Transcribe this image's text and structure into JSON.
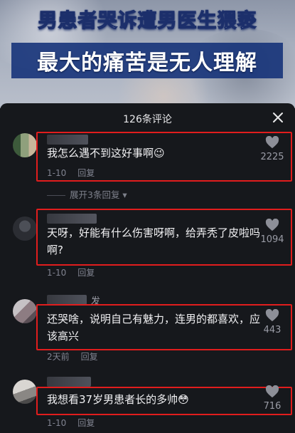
{
  "video": {
    "headline_1": "男患者哭诉遭男医生猥亵",
    "headline_2": "最大的痛苦是无人理解"
  },
  "comments_panel": {
    "title": "126条评论",
    "close_icon": "close-icon",
    "highlight_color": "#e11d1d",
    "comments": [
      {
        "text": "我怎么遇不到这好事啊😉",
        "date": "1-10",
        "reply": "回复",
        "likes": "2225"
      },
      {
        "text": "天呀，好能有什么伤害呀啊，给弄秃了皮啦吗啊?",
        "date": "1-10",
        "reply": "回复",
        "likes": "1094"
      },
      {
        "username_suffix": "发",
        "text": "还哭啥，说明自己有魅力，连男的都喜欢，应该高兴",
        "date": "2天前",
        "reply": "回复",
        "likes": "443"
      },
      {
        "text": "我想看37岁男患者长的多帅😳",
        "date": "1-10",
        "reply": "回复",
        "likes": "716"
      }
    ],
    "expand_replies": "展开3条回复"
  }
}
